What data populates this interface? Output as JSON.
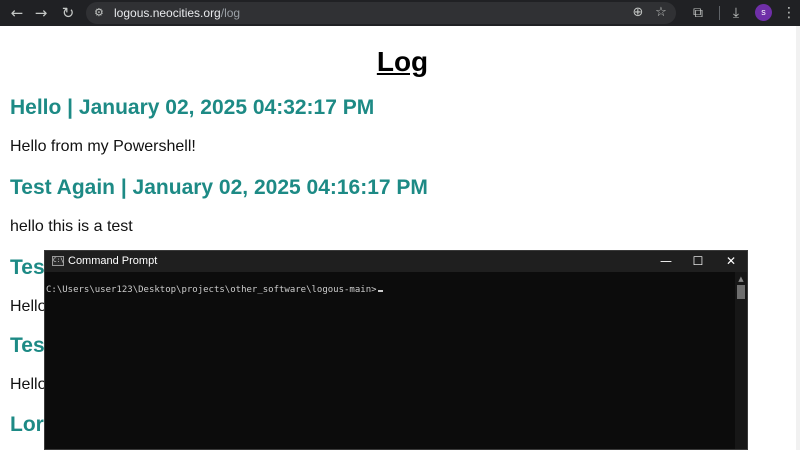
{
  "browser": {
    "back_icon": "←",
    "forward_icon": "→",
    "reload_icon": "↻",
    "site_info_icon": "⚙",
    "url_host": "logous.neocities.org",
    "url_path": "/log",
    "zoom_icon": "⊕",
    "bookmark_icon": "☆",
    "extensions_icon": "⧉",
    "download_icon": "⤓",
    "profile_initial": "s",
    "menu_icon": "⋮",
    "colors": {
      "chrome": "#202124",
      "urlbar": "#303134",
      "profile": "#6f2fa8"
    }
  },
  "page": {
    "title": "Log",
    "entries": [
      {
        "heading": "Hello | January 02, 2025 04:32:17 PM",
        "body": "Hello from my Powershell!"
      },
      {
        "heading": "Test Again | January 02, 2025 04:16:17 PM",
        "body": "hello this is a test"
      },
      {
        "heading": "Tes",
        "body": "Hello"
      },
      {
        "heading": "Tes",
        "body": "Hello"
      },
      {
        "heading": "Lor",
        "body": ""
      }
    ],
    "colors": {
      "heading": "#1d8a85"
    }
  },
  "cmd": {
    "title": "Command Prompt",
    "icon_text": "C:\\",
    "minimize_icon": "—",
    "maximize_icon": "☐",
    "close_icon": "✕",
    "prompt": "C:\\Users\\user123\\Desktop\\projects\\other_software\\logous-main>",
    "scroll_up_icon": "▲",
    "colors": {
      "background": "#0c0c0c",
      "text": "#cccccc"
    }
  }
}
